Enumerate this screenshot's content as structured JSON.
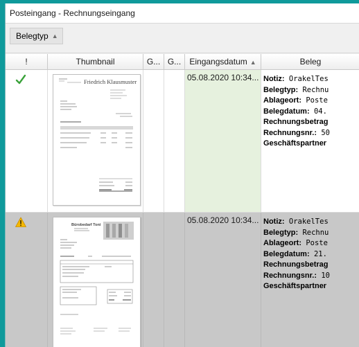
{
  "window": {
    "title": "Posteingang - Rechnungseingang"
  },
  "grouping": {
    "label": "Belegtyp",
    "sort_icon": "sort-ascending-icon"
  },
  "columns": [
    {
      "label": "!"
    },
    {
      "label": "Thumbnail"
    },
    {
      "label": "G..."
    },
    {
      "label": "G..."
    },
    {
      "label": "Eingangsdatum"
    },
    {
      "label": "Beleg"
    }
  ],
  "rows": [
    {
      "status_icon": "checkmark-icon",
      "status_color": "#3aa23a",
      "thumbnail": {
        "company_name": "Friedrich Klausmuster"
      },
      "eingangsdatum": "05.08.2020 10:34...",
      "info": [
        {
          "label": "Notiz:",
          "value": " OrakelTes"
        },
        {
          "label": "Belegtyp:",
          "value": " Rechnu"
        },
        {
          "label": "Ablageort:",
          "value": " Poste"
        },
        {
          "label": "Belegdatum:",
          "value": " 04."
        },
        {
          "label": "Rechnungsbetrag",
          "value": ""
        },
        {
          "label": "Rechnungsnr.:",
          "value": " 50"
        },
        {
          "label": "Geschäftspartner",
          "value": ""
        }
      ]
    },
    {
      "status_icon": "warning-icon",
      "status_color": "#f5b800",
      "thumbnail": {
        "company_name": "Bürobedarf Toni"
      },
      "eingangsdatum": "05.08.2020 10:34...",
      "info": [
        {
          "label": "Notiz:",
          "value": " OrakelTes"
        },
        {
          "label": "Belegtyp:",
          "value": " Rechnu"
        },
        {
          "label": "Ablageort:",
          "value": " Poste"
        },
        {
          "label": "Belegdatum:",
          "value": " 21."
        },
        {
          "label": "Rechnungsbetrag",
          "value": ""
        },
        {
          "label": "Rechnungsnr.:",
          "value": " 10"
        },
        {
          "label": "Geschäftspartner",
          "value": ""
        }
      ]
    }
  ]
}
